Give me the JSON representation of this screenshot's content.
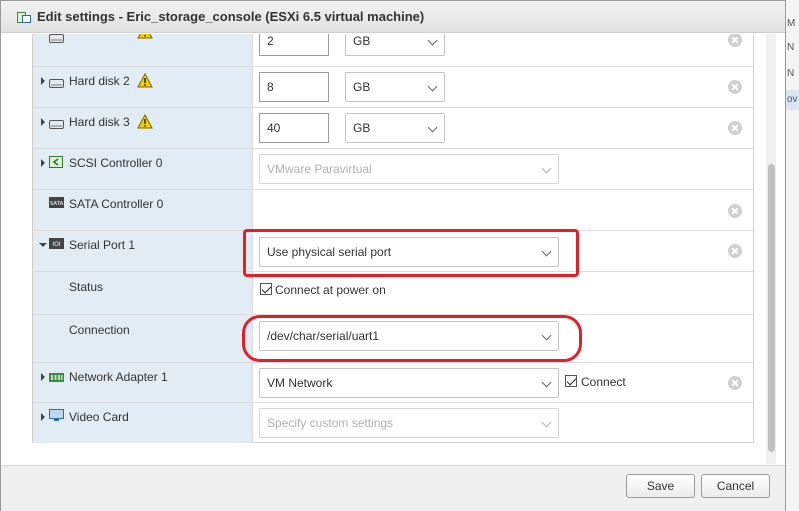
{
  "window": {
    "title": "Edit settings - Eric_storage_console (ESXi 6.5 virtual machine)"
  },
  "background": {
    "right_rows": [
      "M",
      "N",
      "N",
      "ov"
    ]
  },
  "rows": {
    "hd1": {
      "size": "2",
      "unit": "GB"
    },
    "hd2": {
      "label": "Hard disk 2",
      "size": "8",
      "unit": "GB"
    },
    "hd3": {
      "label": "Hard disk 3",
      "size": "40",
      "unit": "GB"
    },
    "scsi": {
      "label": "SCSI Controller 0",
      "value": "VMware Paravirtual"
    },
    "sata": {
      "label": "SATA Controller 0"
    },
    "serial": {
      "label": "Serial Port 1",
      "value": "Use physical serial port"
    },
    "status": {
      "label": "Status",
      "checkbox_label": "Connect at power on"
    },
    "connection": {
      "label": "Connection",
      "value": "/dev/char/serial/uart1"
    },
    "network": {
      "label": "Network Adapter 1",
      "value": "VM Network",
      "checkbox_label": "Connect"
    },
    "video": {
      "label": "Video Card",
      "value": "Specify custom settings"
    }
  },
  "footer": {
    "save_label": "Save",
    "cancel_label": "Cancel"
  },
  "colors": {
    "highlight": "#e0202a",
    "label_column": "#e2ecf5"
  }
}
